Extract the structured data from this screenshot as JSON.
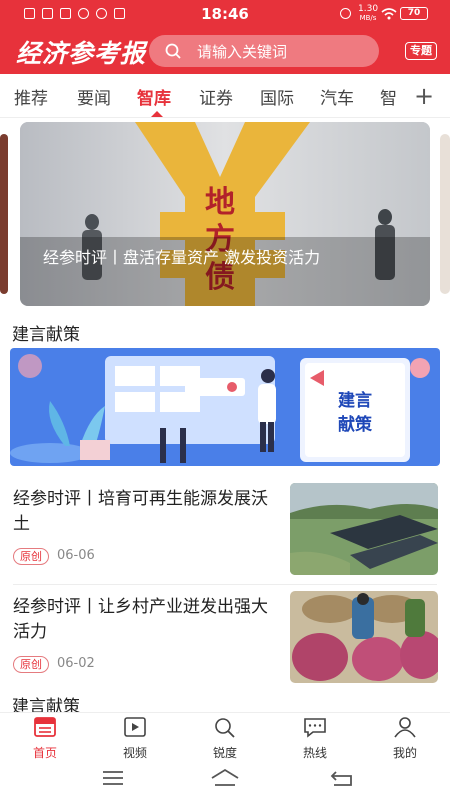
{
  "status_bar": {
    "time": "18:46",
    "net_speed_top": "1.30",
    "net_speed_bottom": "MB/s",
    "battery": "70"
  },
  "header": {
    "logo": "经济参考报",
    "search_placeholder": "请输入关键词",
    "topic_button": "专题"
  },
  "tabs": [
    {
      "label": "推荐",
      "active": false
    },
    {
      "label": "要闻",
      "active": false
    },
    {
      "label": "智库",
      "active": true
    },
    {
      "label": "证券",
      "active": false
    },
    {
      "label": "国际",
      "active": false
    },
    {
      "label": "汽车",
      "active": false
    },
    {
      "label": "智",
      "active": false
    }
  ],
  "banner": {
    "caption": "经参时评丨盘活存量资产 激发投资活力",
    "sign_text": "地方债",
    "icon": "yuan-symbol"
  },
  "sections": {
    "first": "建言献策",
    "second": "建言献策"
  },
  "promo": {
    "sign": "建言献策"
  },
  "articles": [
    {
      "title": "经参时评丨培育可再生能源发展沃土",
      "badge": "原创",
      "date": "06-06"
    },
    {
      "title": "经参时评丨让乡村产业迸发出强大活力",
      "badge": "原创",
      "date": "06-02"
    }
  ],
  "bottom_nav": [
    {
      "label": "首页",
      "icon": "news-icon",
      "active": true
    },
    {
      "label": "视频",
      "icon": "video-icon",
      "active": false
    },
    {
      "label": "锐度",
      "icon": "search-icon",
      "active": false
    },
    {
      "label": "热线",
      "icon": "chat-icon",
      "active": false
    },
    {
      "label": "我的",
      "icon": "user-icon",
      "active": false
    }
  ],
  "colors": {
    "brand": "#e7323b",
    "text": "#222222",
    "muted": "#888888"
  }
}
